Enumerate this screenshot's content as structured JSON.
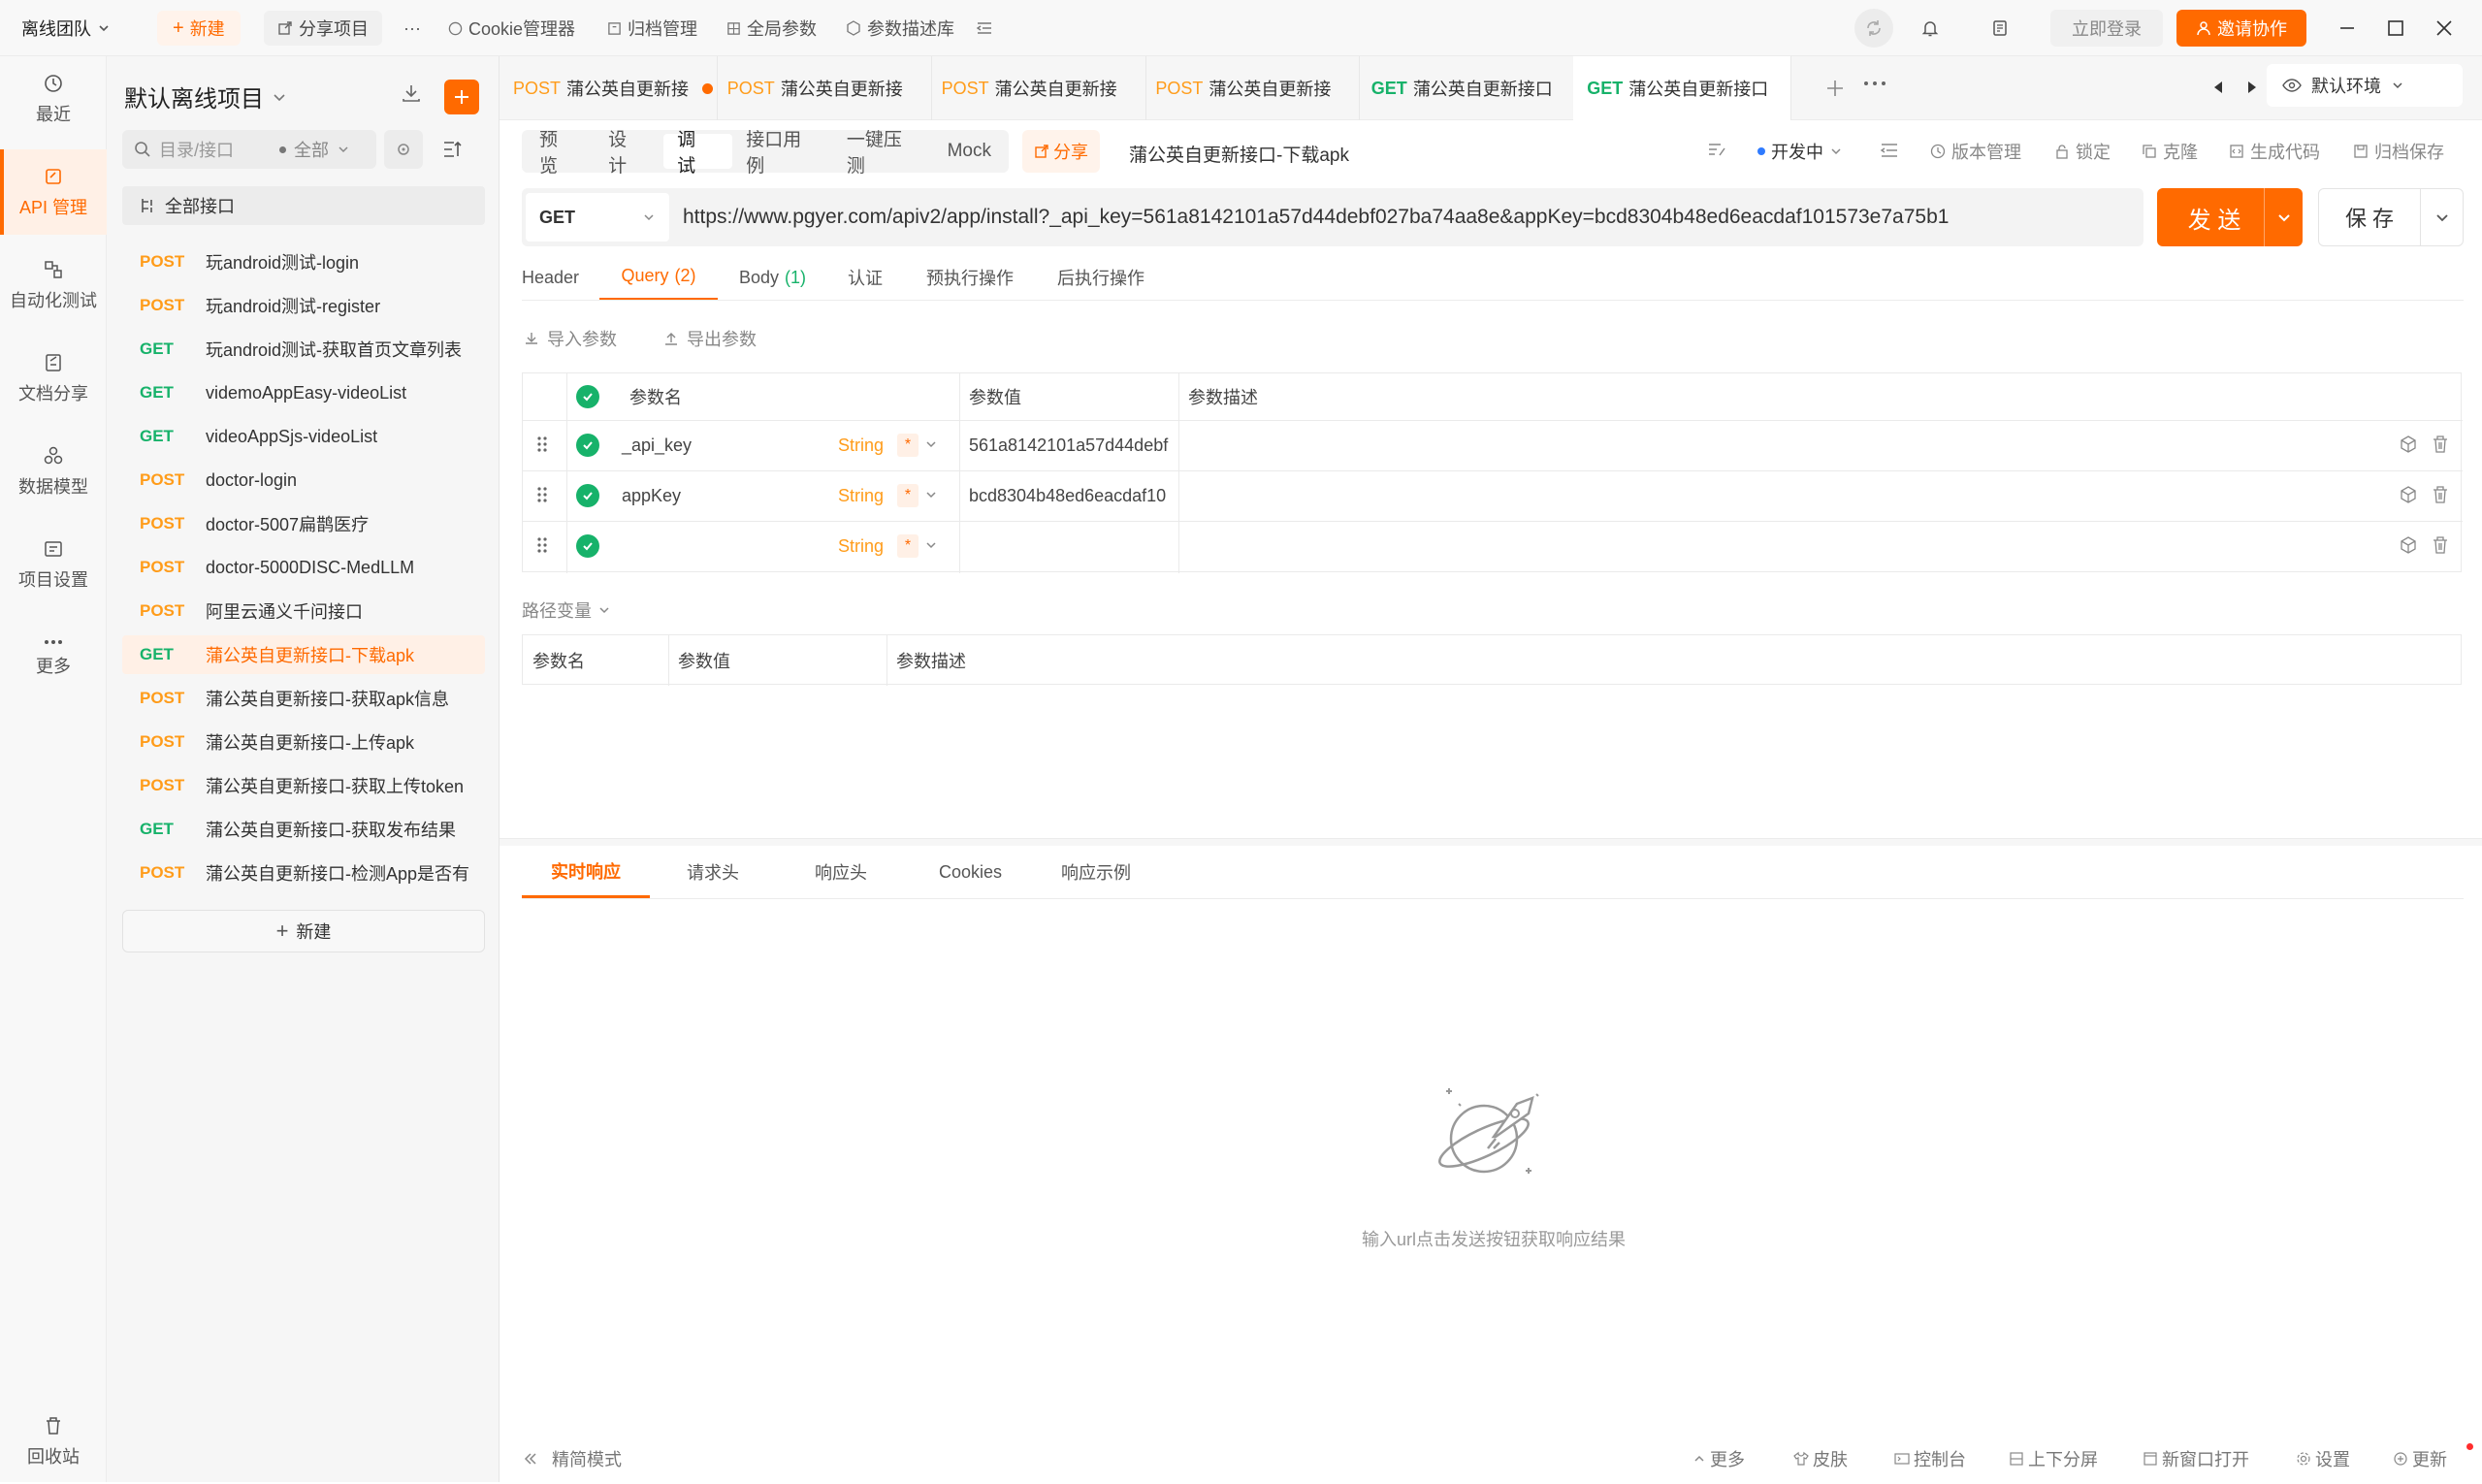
{
  "topbar": {
    "team": "离线团队",
    "new_label": "新建",
    "share_label": "分享项目",
    "more": "···",
    "cookie": "Cookie管理器",
    "archive": "归档管理",
    "global_params": "全局参数",
    "param_lib": "参数描述库",
    "login": "立即登录",
    "invite": "邀请协作"
  },
  "rail": [
    {
      "label": "最近",
      "icon": "clock-icon"
    },
    {
      "label": "API 管理",
      "icon": "api-icon"
    },
    {
      "label": "自动化测试",
      "icon": "flow-icon"
    },
    {
      "label": "文档分享",
      "icon": "doc-share-icon"
    },
    {
      "label": "数据模型",
      "icon": "model-icon"
    },
    {
      "label": "项目设置",
      "icon": "settings-icon"
    },
    {
      "label": "更多",
      "icon": "more-icon"
    },
    {
      "label": "回收站",
      "icon": "trash-icon"
    }
  ],
  "sidebar": {
    "project": "默认离线项目",
    "search_placeholder": "目录/接口",
    "filter": "全部",
    "all_apis": "全部接口",
    "new_label": "新建",
    "items": [
      {
        "method": "POST",
        "name": "玩android测试-login"
      },
      {
        "method": "POST",
        "name": "玩android测试-register"
      },
      {
        "method": "GET",
        "name": "玩android测试-获取首页文章列表"
      },
      {
        "method": "GET",
        "name": "videmoAppEasy-videoList"
      },
      {
        "method": "GET",
        "name": "videoAppSjs-videoList"
      },
      {
        "method": "POST",
        "name": "doctor-login"
      },
      {
        "method": "POST",
        "name": "doctor-5007扁鹊医疗"
      },
      {
        "method": "POST",
        "name": "doctor-5000DISC-MedLLM"
      },
      {
        "method": "POST",
        "name": "阿里云通义千问接口"
      },
      {
        "method": "GET",
        "name": "蒲公英自更新接口-下载apk"
      },
      {
        "method": "POST",
        "name": "蒲公英自更新接口-获取apk信息"
      },
      {
        "method": "POST",
        "name": "蒲公英自更新接口-上传apk"
      },
      {
        "method": "POST",
        "name": "蒲公英自更新接口-获取上传token"
      },
      {
        "method": "GET",
        "name": "蒲公英自更新接口-获取发布结果"
      },
      {
        "method": "POST",
        "name": "蒲公英自更新接口-检测App是否有"
      }
    ]
  },
  "tabs": [
    {
      "method": "POST",
      "name": "蒲公英自更新接"
    },
    {
      "method": "POST",
      "name": "蒲公英自更新接"
    },
    {
      "method": "POST",
      "name": "蒲公英自更新接"
    },
    {
      "method": "POST",
      "name": "蒲公英自更新接"
    },
    {
      "method": "GET",
      "name": "蒲公英自更新接口"
    },
    {
      "method": "GET",
      "name": "蒲公英自更新接口"
    }
  ],
  "env": "默认环境",
  "toolbar": {
    "modes": [
      "预 览",
      "设 计",
      "调 试",
      "接口用例",
      "一键压测",
      "Mock"
    ],
    "share": "分享",
    "api_name": "蒲公英自更新接口-下载apk",
    "status": "开发中",
    "version": "版本管理",
    "lock": "锁定",
    "clone": "克隆",
    "gen_code": "生成代码",
    "archive_save": "归档保存"
  },
  "request": {
    "method": "GET",
    "url": "https://www.pgyer.com/apiv2/app/install?_api_key=561a8142101a57d44debf027ba74aa8e&appKey=bcd8304b48ed6eacdaf101573e7a75b1",
    "send": "发 送",
    "save": "保 存"
  },
  "req_tabs": {
    "header": "Header",
    "query": "Query",
    "query_count": "(2)",
    "body": "Body",
    "body_count": "(1)",
    "auth": "认证",
    "pre": "预执行操作",
    "post": "后执行操作"
  },
  "params": {
    "import": "导入参数",
    "export": "导出参数",
    "col_name": "参数名",
    "col_value": "参数值",
    "col_desc": "参数描述",
    "rows": [
      {
        "name": "_api_key",
        "type": "String",
        "required": "*",
        "value": "561a8142101a57d44debf"
      },
      {
        "name": "appKey",
        "type": "String",
        "required": "*",
        "value": "bcd8304b48ed6eacdaf10"
      },
      {
        "name": "",
        "type": "String",
        "required": "*",
        "value": ""
      }
    ]
  },
  "path_vars": {
    "title": "路径变量",
    "col_name": "参数名",
    "col_value": "参数值",
    "col_desc": "参数描述"
  },
  "response": {
    "tabs": [
      "实时响应",
      "请求头",
      "响应头",
      "Cookies",
      "响应示例"
    ],
    "empty_text": "输入url点击发送按钮获取响应结果"
  },
  "statusbar": {
    "simple_mode": "精简模式",
    "more": "更多",
    "skin": "皮肤",
    "console": "控制台",
    "split": "上下分屏",
    "new_window": "新窗口打开",
    "settings": "设置",
    "update": "更新"
  },
  "colors": {
    "accent": "#ff6a00",
    "get": "#17b26a",
    "post": "#ff9c1a"
  }
}
